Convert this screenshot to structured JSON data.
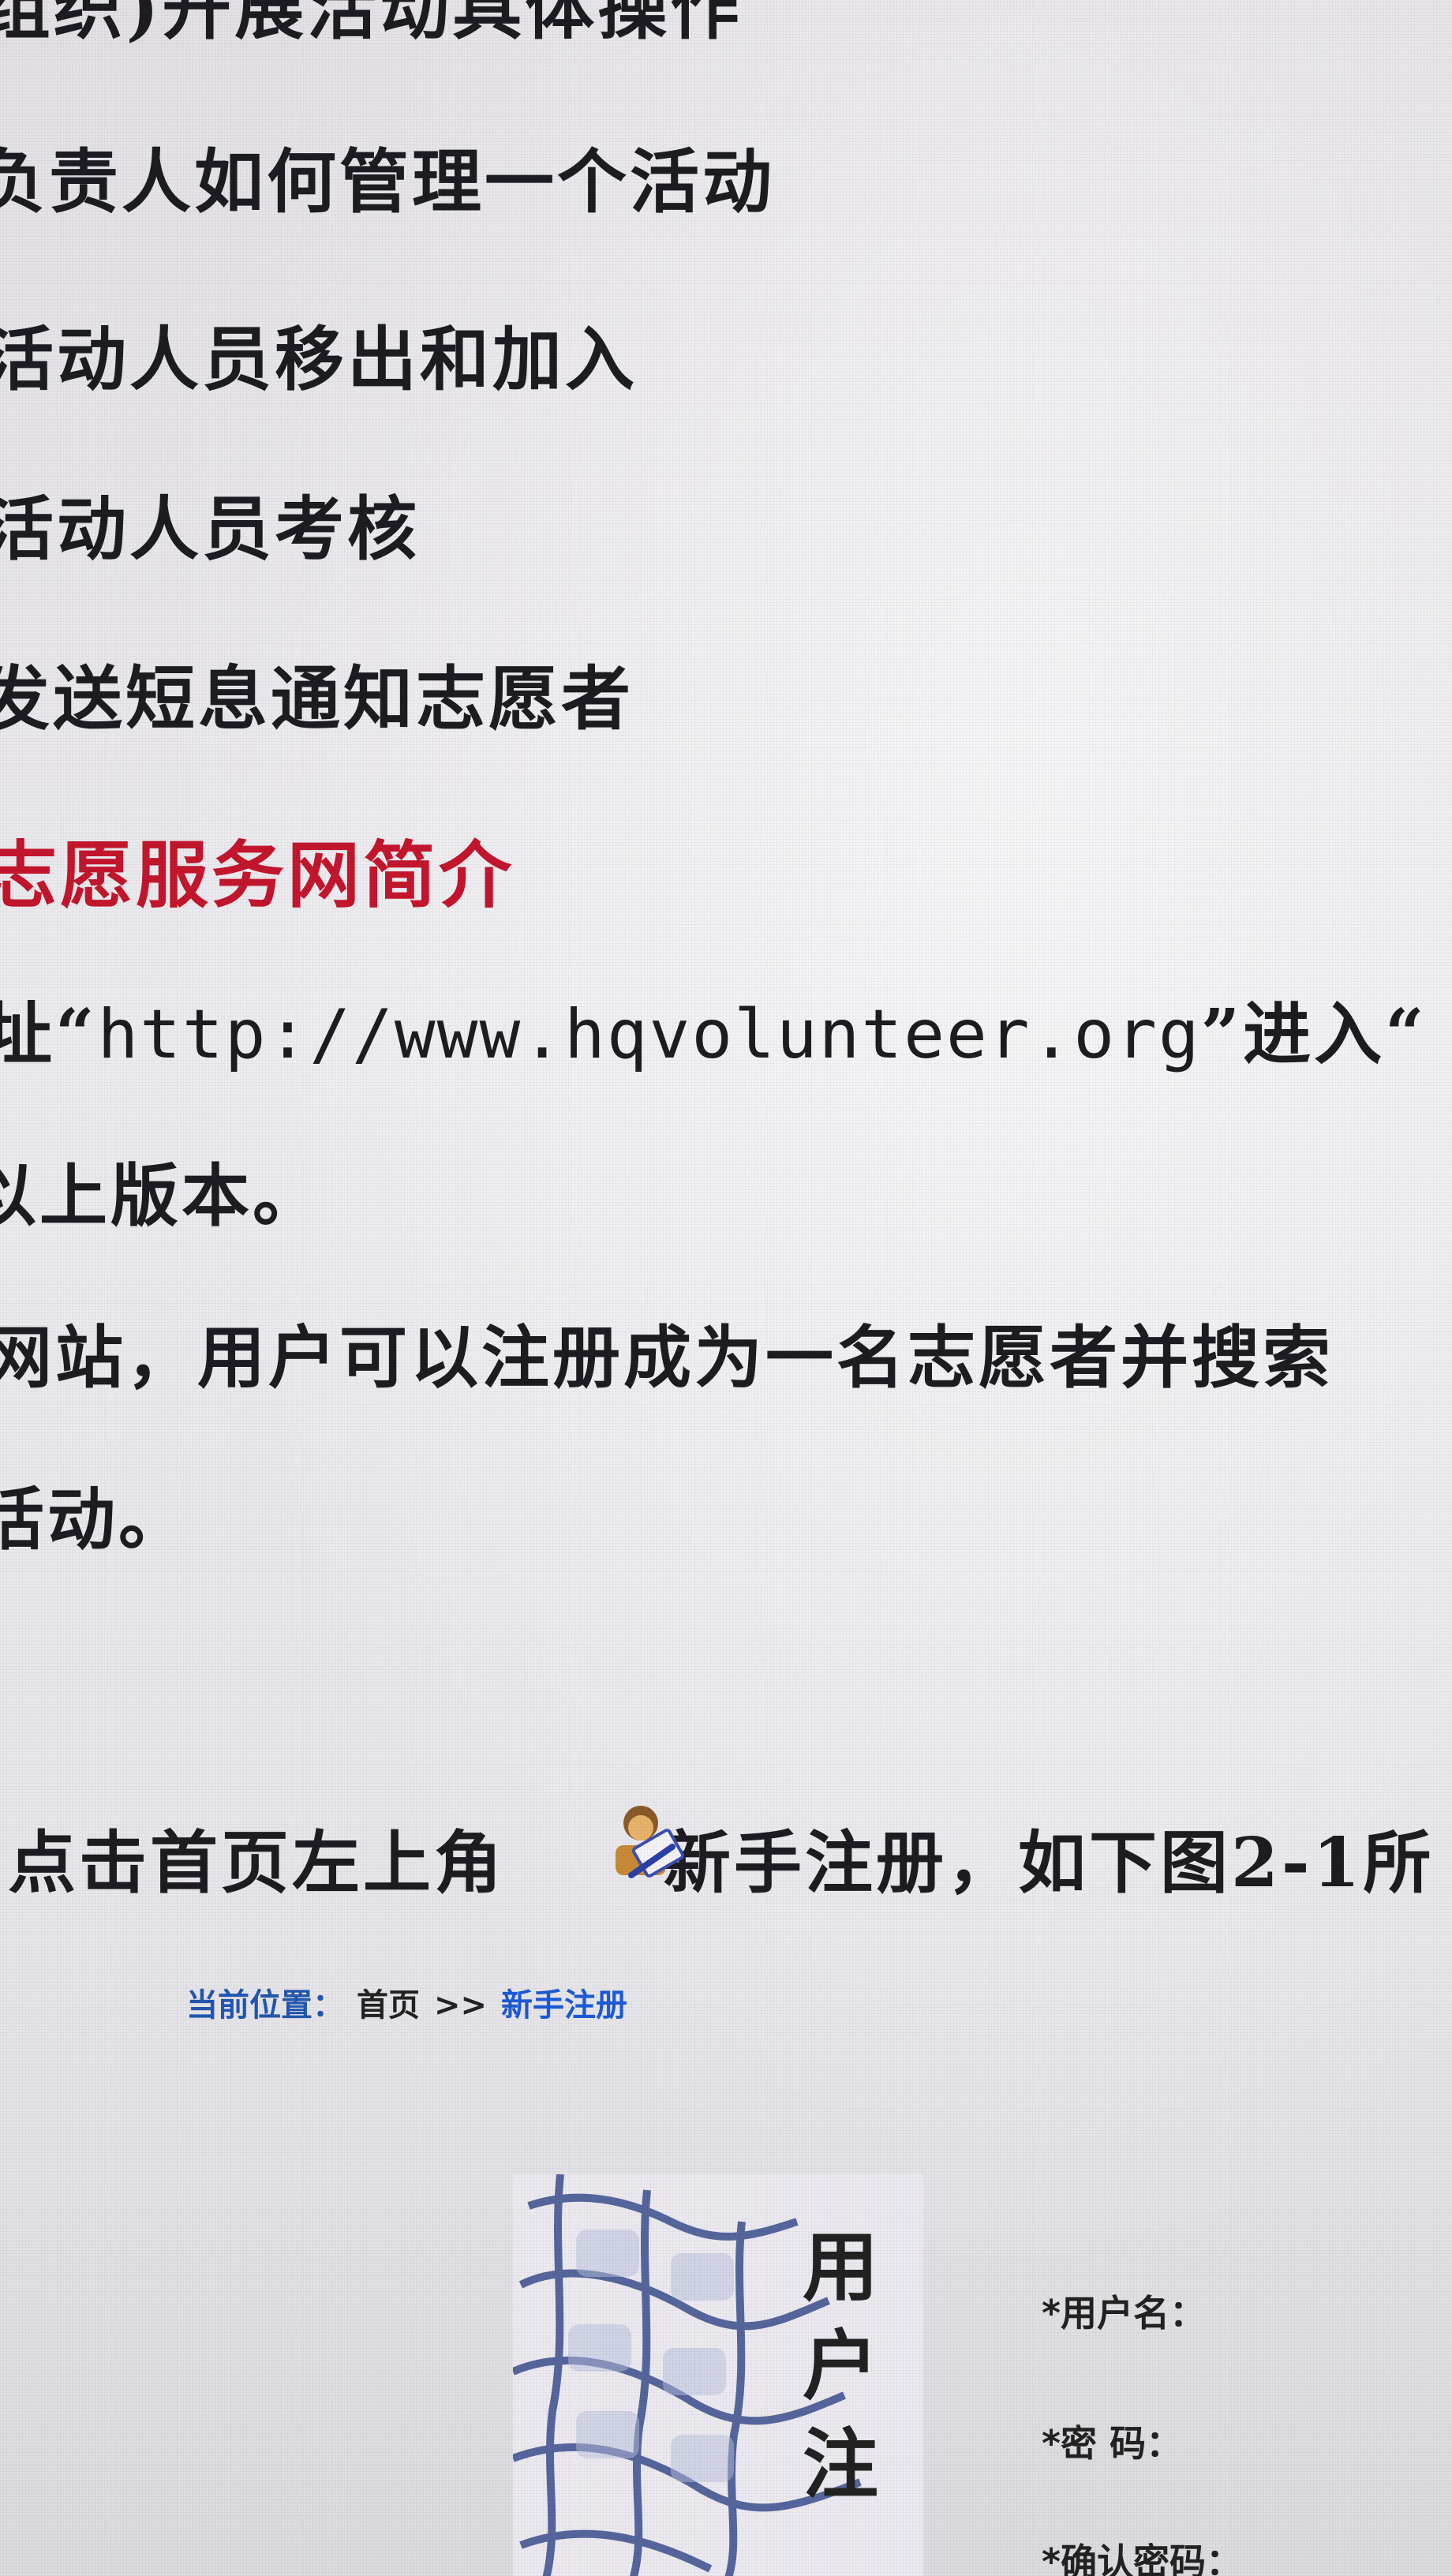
{
  "toc_items": [
    "(组织)开展活动具体操作",
    "负责人如何管理一个活动",
    "活动人员移出和加入",
    "活动人员考核",
    "发送短息通知志愿者"
  ],
  "section_heading": "志愿服务网简介",
  "url_line": {
    "prefix": "址“",
    "url": "http://www.hqvolunteer.org",
    "suffix": "”进入“"
  },
  "version_line": "以上版本。",
  "desc_line1": "网站，用户可以注册成为一名志愿者并搜索",
  "desc_line2": "活动。",
  "step_line": {
    "prefix": "点击首页左上角",
    "link_text": "新手注册",
    "suffix": "，如下图2-1所"
  },
  "breadcrumb": {
    "label": "当前位置：",
    "home": "首页",
    "separator": ">>",
    "current": "新手注册"
  },
  "form_preview": {
    "title_chars": [
      "用",
      "户",
      "注"
    ],
    "fields": [
      "*用户名：",
      "*密    码：",
      "*确认密码："
    ]
  },
  "colors": {
    "heading": "#c4162d",
    "breadcrumb_link": "#1d5bd6"
  },
  "icons": {
    "register": "register-user-icon",
    "keyboard": "keyboard-image"
  }
}
